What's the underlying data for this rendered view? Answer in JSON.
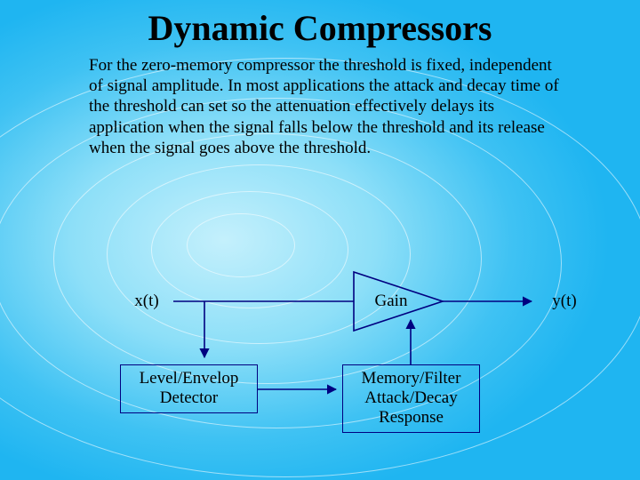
{
  "title": "Dynamic Compressors",
  "body": "For the zero-memory compressor the threshold is fixed, independent of signal amplitude.  In most applications the attack and decay time of the threshold can set so the attenuation effectively delays its application when the signal falls below the threshold and its release when the signal goes above the threshold.",
  "diagram": {
    "input_label": "x(t)",
    "output_label": "y(t)",
    "gain_label": "Gain",
    "detector_label_l1": "Level/Envelop",
    "detector_label_l2": "Detector",
    "filter_label_l1": "Memory/Filter",
    "filter_label_l2": "Attack/Decay",
    "filter_label_l3": "Response"
  },
  "colors": {
    "stroke": "#000080",
    "fill_arrow": "#000080"
  }
}
